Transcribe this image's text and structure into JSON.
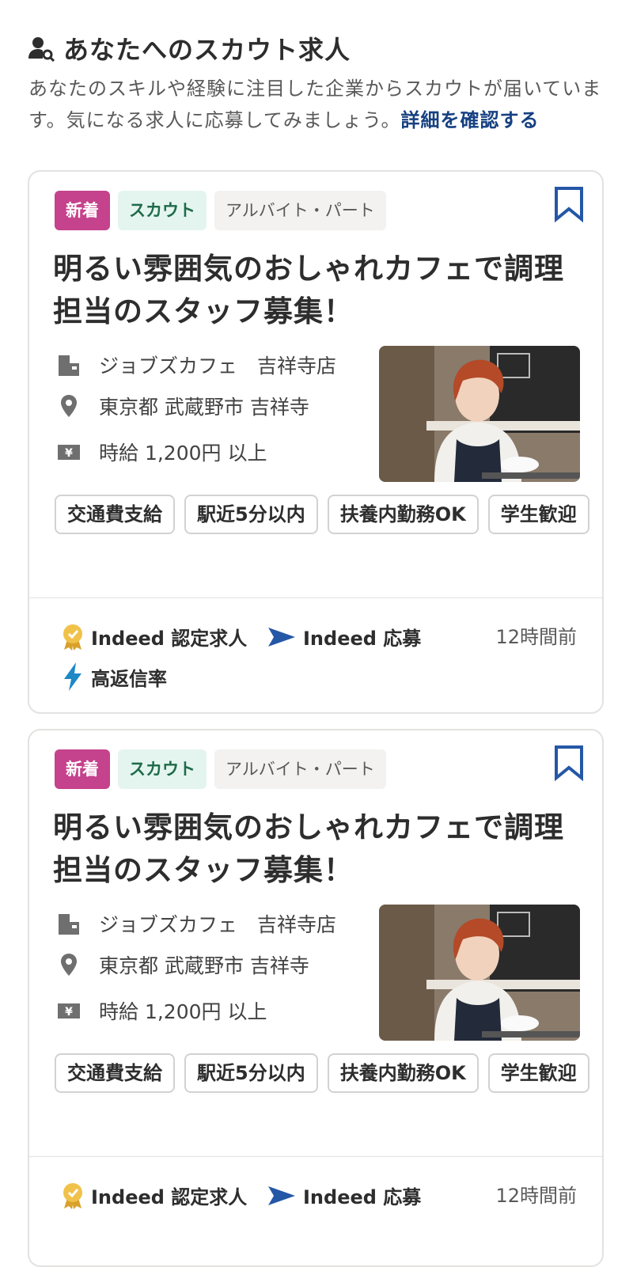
{
  "header": {
    "title": "あなたへのスカウト求人",
    "description": "あなたのスキルや経験に注目した企業からスカウトが届いています。気になる求人に応募してみましょう。",
    "link": "詳細を確認する"
  },
  "cards": [
    {
      "badge_new": "新着",
      "badge_scout": "スカウト",
      "job_type": "アルバイト・パート",
      "title": "明るい雰囲気のおしゃれカフェで調理担当のスタッフ募集！",
      "company": "ジョブズカフェ　吉祥寺店",
      "location": "東京都 武蔵野市 吉祥寺",
      "salary": "時給 1,200円 以上",
      "features": [
        "交通費支給",
        "駅近5分以内",
        "扶養内勤務OK",
        "学生歓迎"
      ],
      "certified": "Indeed 認定求人",
      "apply": "Indeed 応募",
      "high_response": "高返信率",
      "posted": "12時間前"
    },
    {
      "badge_new": "新着",
      "badge_scout": "スカウト",
      "job_type": "アルバイト・パート",
      "title": "明るい雰囲気のおしゃれカフェで調理担当のスタッフ募集！",
      "company": "ジョブズカフェ　吉祥寺店",
      "location": "東京都 武蔵野市 吉祥寺",
      "salary": "時給 1,200円 以上",
      "features": [
        "交通費支給",
        "駅近5分以内",
        "扶養内勤務OK",
        "学生歓迎"
      ],
      "certified": "Indeed 認定求人",
      "apply": "Indeed 応募",
      "posted": "12時間前"
    }
  ],
  "colors": {
    "accent_link": "#164081",
    "badge_new": "#c5428c",
    "badge_scout_bg": "#e4f5ef",
    "bookmark": "#2557a7",
    "bolt": "#1e88c7"
  },
  "icons": {
    "header": "person-search-icon",
    "bookmark": "bookmark-icon",
    "company": "building-icon",
    "location": "location-pin-icon",
    "salary": "yen-icon",
    "certified": "award-badge-icon",
    "apply": "arrow-send-icon",
    "high_response": "lightning-bolt-icon"
  }
}
